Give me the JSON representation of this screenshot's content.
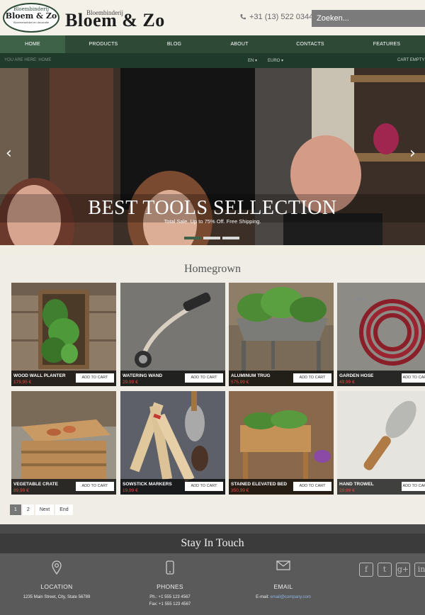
{
  "header": {
    "logo_top": "Bloembinderij",
    "logo_name": "Bloem & Zo",
    "logo_tagline": "Bloemenwinkel en decoratie",
    "brand_small": "Bloembinderij",
    "brand": "Bloem & Zo",
    "phone": "+31 (13) 522 0344",
    "search_placeholder": "Zoeken..."
  },
  "nav": {
    "items": [
      {
        "label": "Home"
      },
      {
        "label": "Products"
      },
      {
        "label": "Blog"
      },
      {
        "label": "About"
      },
      {
        "label": "Contacts"
      },
      {
        "label": "Features"
      }
    ]
  },
  "subnav": {
    "breadcrumb": "You are here: Home",
    "language": "EN ▾",
    "currency": "EURO ▾",
    "cart": "Cart empty"
  },
  "hero": {
    "title": "BEST TOOLS SELLECTION",
    "subtitle": "Total Sale. Up to 75% Off. Free Shipping.",
    "prev": "‹",
    "next": "›"
  },
  "section": {
    "title": "Homegrown"
  },
  "products": [
    {
      "name": "Wood Wall Planter",
      "price": "179,95 €",
      "button": "Add to cart"
    },
    {
      "name": "Watering Wand",
      "price": "29,99 €",
      "button": "Add to cart"
    },
    {
      "name": "Aluminum Trug",
      "price": "575,99 €",
      "button": "Add to cart"
    },
    {
      "name": "Garden Hose",
      "price": "49,99 €",
      "button": "Add to cart"
    },
    {
      "name": "Vegetable Crate",
      "price": "89,99 €",
      "button": "Add to cart"
    },
    {
      "name": "Sowstick Markers",
      "price": "19,99 €",
      "button": "Add to cart"
    },
    {
      "name": "Stained Elevated Bed",
      "price": "350,99 €",
      "button": "Add to cart"
    },
    {
      "name": "Hand Trowel",
      "price": "29,99 €",
      "button": "Add to cart"
    }
  ],
  "pagination": {
    "p1": "1",
    "p2": "2",
    "next": "Next",
    "end": "End"
  },
  "footer": {
    "title": "Stay In Touch",
    "location": {
      "heading": "Location",
      "line": "1235 Main Street, City, State 56789"
    },
    "phones": {
      "heading": "Phones",
      "line1": "Ph.: +1 555 123 4567",
      "line2": "Fax: +1 555 123 4567"
    },
    "email": {
      "heading": "Email",
      "label": "E-mail:",
      "address": "email@company.com"
    },
    "social": [
      "f",
      "t",
      "g+",
      "in"
    ]
  },
  "colors": {
    "nav": "#2e4a36",
    "nav_active": "#3e6248",
    "price": "#e24c3e",
    "footer": "#5a5a5a"
  }
}
